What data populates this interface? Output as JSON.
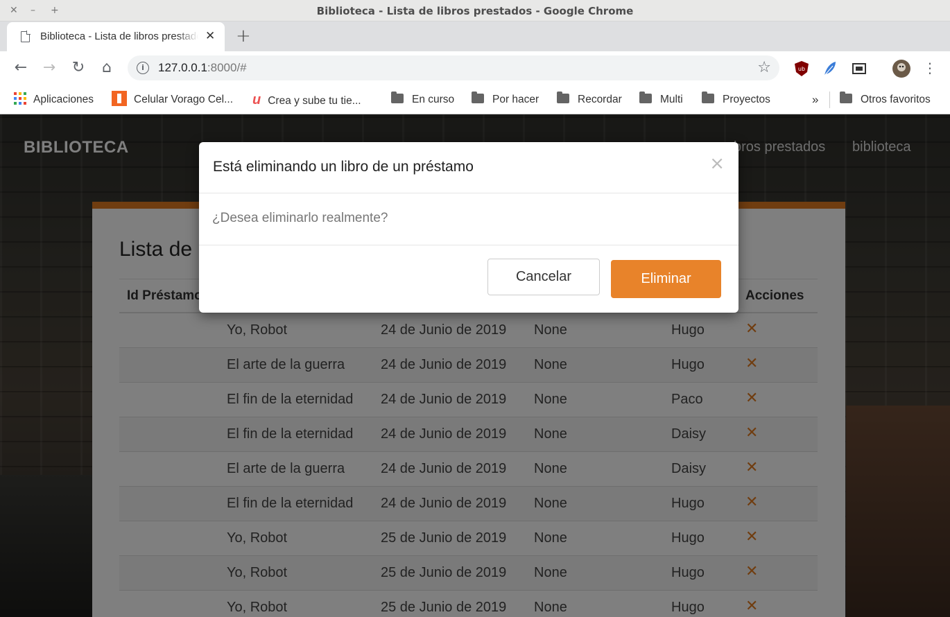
{
  "window": {
    "title": "Biblioteca - Lista de libros prestados - Google Chrome"
  },
  "tab": {
    "label": "Biblioteca - Lista de libros prestados",
    "close": "✕"
  },
  "toolbar": {
    "url_host": "127.0.0.1",
    "url_rest": ":8000/#"
  },
  "bookmarks": {
    "items": [
      "Aplicaciones",
      "Celular Vorago Cel...",
      "Crea y sube tu tie...",
      "En curso",
      "Por hacer",
      "Recordar",
      "Multi",
      "Proyectos"
    ],
    "more": "»",
    "other": "Otros favoritos"
  },
  "site": {
    "brand": "BIBLIOTECA",
    "nav": [
      "libros prestados",
      "biblioteca"
    ],
    "nav_visible": [
      "bros prestados",
      "biblioteca"
    ]
  },
  "main": {
    "title": "Lista de libros prestados",
    "title_visible": "Lista de l",
    "columns": [
      "Id Préstamo",
      "Acciones"
    ],
    "rows": [
      {
        "book": "Yo, Robot",
        "date": "24 de Junio de 2019",
        "ret": "None",
        "user": "Hugo"
      },
      {
        "book": "El arte de la guerra",
        "date": "24 de Junio de 2019",
        "ret": "None",
        "user": "Hugo"
      },
      {
        "book": "El fin de la eternidad",
        "date": "24 de Junio de 2019",
        "ret": "None",
        "user": "Paco"
      },
      {
        "book": "El fin de la eternidad",
        "date": "24 de Junio de 2019",
        "ret": "None",
        "user": "Daisy"
      },
      {
        "book": "El arte de la guerra",
        "date": "24 de Junio de 2019",
        "ret": "None",
        "user": "Daisy"
      },
      {
        "book": "El fin de la eternidad",
        "date": "24 de Junio de 2019",
        "ret": "None",
        "user": "Hugo"
      },
      {
        "book": "Yo, Robot",
        "date": "25 de Junio de 2019",
        "ret": "None",
        "user": "Hugo"
      },
      {
        "book": "Yo, Robot",
        "date": "25 de Junio de 2019",
        "ret": "None",
        "user": "Hugo"
      },
      {
        "book": "Yo, Robot",
        "date": "25 de Junio de 2019",
        "ret": "None",
        "user": "Hugo"
      }
    ],
    "delete_icon": "✕"
  },
  "modal": {
    "title": "Está eliminando un libro de un préstamo",
    "close": "×",
    "message": "¿Desea eliminarlo realmente?",
    "cancel": "Cancelar",
    "confirm": "Eliminar"
  },
  "colors": {
    "accent": "#e07b20",
    "button": "#e8832a"
  }
}
